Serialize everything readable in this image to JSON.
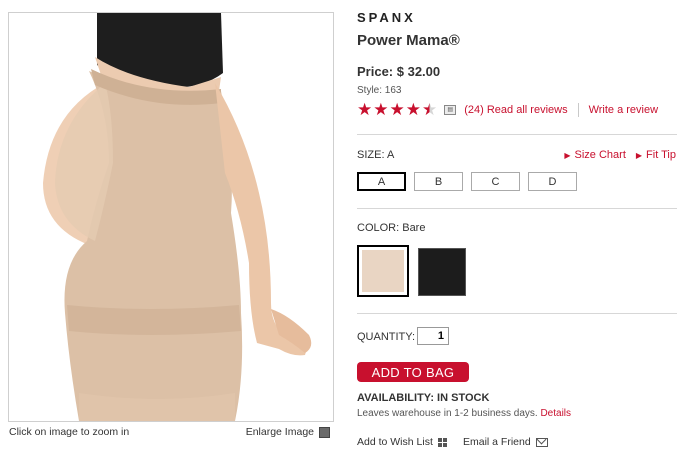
{
  "product_image": {
    "alt": "Power Mama shaper worn by pregnant model"
  },
  "image_footer": {
    "zoom_hint": "Click on image to zoom in",
    "enlarge_label": "Enlarge Image"
  },
  "brand": "SPANX",
  "product_name": "Power Mama®",
  "price": "Price: $ 32.00",
  "style": "Style: 163",
  "rating": {
    "stars": 4.5,
    "max": 5,
    "reviews_link": "(24) Read all reviews",
    "write_review": "Write a review"
  },
  "size": {
    "label": "SIZE: A",
    "chart_link": "Size Chart",
    "fit_tip_link": "Fit Tip",
    "options": [
      "A",
      "B",
      "C",
      "D"
    ],
    "selected": "A"
  },
  "color": {
    "label": "COLOR: Bare",
    "swatches": [
      {
        "name": "Bare",
        "hex": "#e9d5c3"
      },
      {
        "name": "Black",
        "hex": "#1c1c1c"
      }
    ]
  },
  "quantity": {
    "label": "QUANTITY:",
    "value": "1"
  },
  "add_to_bag": "ADD TO BAG",
  "availability": "AVAILABILITY: IN STOCK",
  "shipping": {
    "text": "Leaves warehouse in 1-2 business days.",
    "details_link": "Details"
  },
  "wishlist_label": "Add to Wish List",
  "email_label": "Email a Friend",
  "colors": {
    "accent": "#c8102e"
  }
}
